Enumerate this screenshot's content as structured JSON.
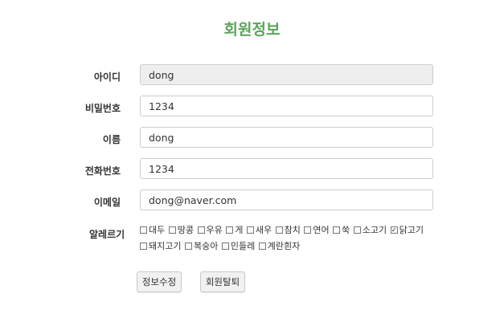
{
  "page": {
    "title": "회원정보"
  },
  "form": {
    "id": {
      "label": "아이디",
      "value": "dong"
    },
    "password": {
      "label": "비밀번호",
      "value": "1234"
    },
    "name": {
      "label": "이름",
      "value": "dong"
    },
    "phone": {
      "label": "전화번호",
      "value": "1234"
    },
    "email": {
      "label": "이메일",
      "value": "dong@naver.com"
    },
    "allergy": {
      "label": "알레르기",
      "options": [
        {
          "label": "대두",
          "checked": false
        },
        {
          "label": "땅콩",
          "checked": false
        },
        {
          "label": "우유",
          "checked": false
        },
        {
          "label": "게",
          "checked": false
        },
        {
          "label": "새우",
          "checked": false
        },
        {
          "label": "참치",
          "checked": false
        },
        {
          "label": "연어",
          "checked": false
        },
        {
          "label": "쑥",
          "checked": false
        },
        {
          "label": "소고기",
          "checked": false
        },
        {
          "label": "닭고기",
          "checked": true
        },
        {
          "label": "돼지고기",
          "checked": false
        },
        {
          "label": "복숭아",
          "checked": false
        },
        {
          "label": "민들레",
          "checked": false
        },
        {
          "label": "계란흰자",
          "checked": false
        }
      ]
    }
  },
  "buttons": {
    "edit": "정보수정",
    "leave": "회원탈퇴"
  }
}
